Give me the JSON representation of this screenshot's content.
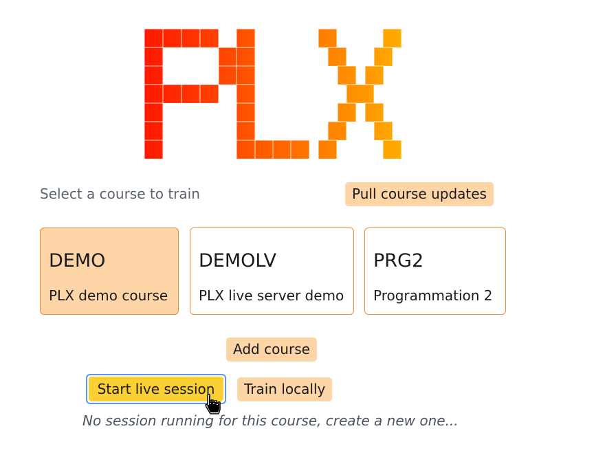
{
  "logo": {
    "text": "PLX",
    "colors": [
      "#ff1a00",
      "#ff6a00",
      "#ffad00"
    ]
  },
  "select_label": "Select a course to train",
  "pull_button": "Pull course updates",
  "courses": [
    {
      "code": "DEMO",
      "name": "PLX demo course",
      "selected": true
    },
    {
      "code": "DEMOLV",
      "name": "PLX live server demo",
      "selected": false
    },
    {
      "code": "PRG2",
      "name": "Programmation 2",
      "selected": false
    }
  ],
  "add_course_button": "Add course",
  "start_live_button": "Start live session",
  "train_locally_button": "Train locally",
  "session_message": "No session running for this course, create a new one...",
  "cursor": "hand-pointer-icon"
}
